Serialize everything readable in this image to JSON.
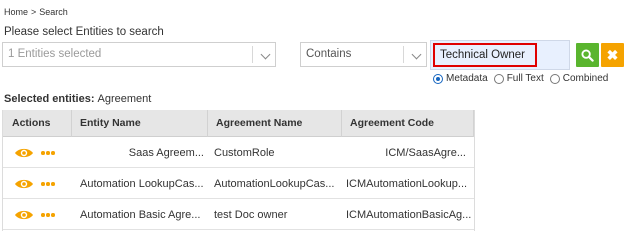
{
  "breadcrumb": {
    "home": "Home",
    "separator": ">",
    "current": "Search"
  },
  "prompt": "Please select Entities to search",
  "entity_select": {
    "value": "1 Entities selected",
    "icon": "chevron-down-icon"
  },
  "operator_select": {
    "value": "Contains",
    "icon": "chevron-down-icon"
  },
  "search_field": {
    "value": "Technical Owner",
    "highlight_color": "#e00000"
  },
  "buttons": {
    "search": {
      "icon": "search-icon",
      "color": "#5ab52e"
    },
    "clear": {
      "icon": "close-icon",
      "glyph": "✖",
      "color": "#f5a300"
    }
  },
  "search_modes": [
    {
      "label": "Metadata",
      "checked": true
    },
    {
      "label": "Full Text",
      "checked": false
    },
    {
      "label": "Combined",
      "checked": false
    }
  ],
  "selected_entities": {
    "label": "Selected entities:",
    "value": "Agreement"
  },
  "table": {
    "columns": [
      "Actions",
      "Entity Name",
      "Agreement Name",
      "Agreement Code"
    ],
    "action_icons": [
      "eye-icon",
      "more-dots-icon"
    ],
    "accent_color": "#f5a300",
    "rows": [
      {
        "entity_name": "Saas Agreem...",
        "agreement_name": "CustomRole",
        "agreement_code": "ICM/SaasAgre..."
      },
      {
        "entity_name": "Automation LookupCas...",
        "agreement_name": "AutomationLookupCas...",
        "agreement_code": "ICMAutomationLookup..."
      },
      {
        "entity_name": "Automation Basic Agre...",
        "agreement_name": "test Doc owner",
        "agreement_code": "ICMAutomationBasicAg..."
      }
    ]
  }
}
